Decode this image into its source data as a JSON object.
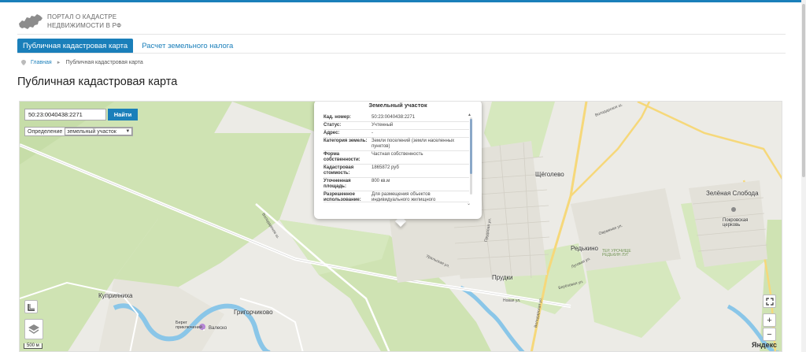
{
  "header": {
    "logo_line1": "ПОРТАЛ О КАДАСТРЕ",
    "logo_line2": "НЕДВИЖИМОСТИ В РФ"
  },
  "nav": {
    "tabs": [
      {
        "label": "Публичная кадастровая карта",
        "active": true
      },
      {
        "label": "Расчет земельного налога",
        "active": false
      }
    ]
  },
  "breadcrumb": {
    "home": "Главная",
    "current": "Публичная кадастровая карта"
  },
  "page_title": "Публичная кадастровая карта",
  "colors": {
    "accent": "#1a7fba",
    "road": "#f6d87a",
    "forest": "#cfe3b3",
    "water": "#8ac6e8"
  },
  "search": {
    "value": "50:23:0040438:2271",
    "button": "Найти",
    "definition_label": "Определение",
    "definition_value": "земельный участок"
  },
  "popup": {
    "title": "Земельный участок",
    "rows": [
      {
        "key": "Кад. номер:",
        "value": "50:23:0040438:2271"
      },
      {
        "key": "Статус:",
        "value": "Учтенный"
      },
      {
        "key": "Адрес:",
        "value": "-"
      },
      {
        "key": "Категория земель:",
        "value": "Земли поселений (земли населенных пунктов)"
      },
      {
        "key": "Форма собственности:",
        "value": "Частная собственность"
      },
      {
        "key": "Кадастровая стоимость:",
        "value": "1865872 руб"
      },
      {
        "key": "Уточненная площадь:",
        "value": "800 кв.м"
      },
      {
        "key": "Разрешенное использование:",
        "value": "Для размещения объектов индивидуального жилищного"
      }
    ]
  },
  "map": {
    "places": {
      "shchegolevo": "Щёголево",
      "zelenaya_sloboda": "Зелёная Слобода",
      "pokrovskaya": "Покровская церковь",
      "redkino": "Редькино",
      "redkino_park": "ТЕР. УРОЧИЩЕ РЕДЬКИН ЛУГ",
      "prudki": "Прудки",
      "kupriyanikha": "Куприяниха",
      "grigorchikovo": "Григорчиково",
      "bereg": "Берег приключений",
      "valesko": "Валеско"
    },
    "streets": {
      "volodarskoe": "Володарское ш.",
      "volodarskoe2": "Володарское ш.",
      "volodarskaya": "Володарская ул.",
      "novaya": "Новая ул.",
      "berezovaya": "Берёзовая ул.",
      "lugovaya": "Луговая ул.",
      "ovrazhnaya": "Овражная ул.",
      "uralskaya": "Уральская ул.",
      "prudovaya": "Прудовая ул."
    },
    "scale": "500 м",
    "attribution": "Яндекс"
  },
  "controls": {
    "zoom_in": "+",
    "zoom_out": "−"
  }
}
